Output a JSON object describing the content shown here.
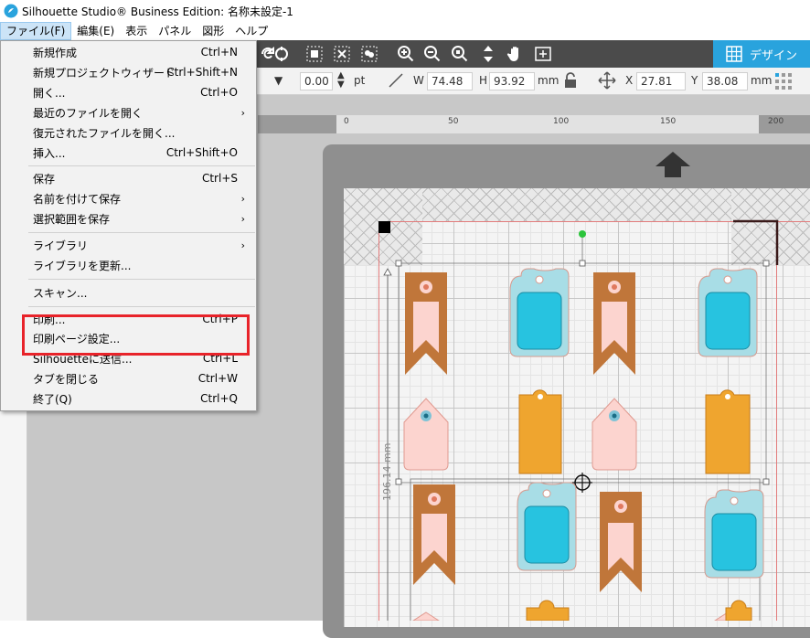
{
  "window": {
    "title": "Silhouette Studio® Business Edition: 名称未設定-1"
  },
  "menubar": {
    "items": [
      {
        "label": "ファイル(F)"
      },
      {
        "label": "編集(E)"
      },
      {
        "label": "表示"
      },
      {
        "label": "パネル"
      },
      {
        "label": "図形"
      },
      {
        "label": "ヘルプ"
      }
    ]
  },
  "file_menu": {
    "items": [
      {
        "label": "新規作成",
        "shortcut": "Ctrl+N"
      },
      {
        "label": "新規プロジェクトウィザード",
        "shortcut": "Ctrl+Shift+N"
      },
      {
        "label": "開く...",
        "shortcut": "Ctrl+O"
      },
      {
        "label": "最近のファイルを開く",
        "shortcut": "›"
      },
      {
        "label": "復元されたファイルを開く..."
      },
      {
        "label": "挿入...",
        "shortcut": "Ctrl+Shift+O"
      },
      {
        "label": "保存",
        "shortcut": "Ctrl+S"
      },
      {
        "label": "名前を付けて保存",
        "shortcut": "›"
      },
      {
        "label": "選択範囲を保存",
        "shortcut": "›"
      },
      {
        "label": "ライブラリ",
        "shortcut": "›"
      },
      {
        "label": "ライブラリを更新..."
      },
      {
        "label": "スキャン..."
      },
      {
        "label": "印刷...",
        "shortcut": "Ctrl+P"
      },
      {
        "label": "印刷ページ設定..."
      },
      {
        "label": "Silhouetteに送信...",
        "shortcut": "Ctrl+L"
      },
      {
        "label": "タブを閉じる",
        "shortcut": "Ctrl+W"
      },
      {
        "label": "終了(Q)",
        "shortcut": "Ctrl+Q"
      }
    ]
  },
  "design_tab": {
    "label": "デザイン"
  },
  "toolbar2": {
    "line_width": "0.00",
    "line_unit": "pt",
    "w_label": "W",
    "w_value": "74.48",
    "h_label": "H",
    "h_value": "93.92",
    "size_unit": "mm",
    "x_label": "X",
    "x_value": "27.81",
    "y_label": "Y",
    "y_value": "38.08",
    "pos_unit": "mm"
  },
  "ruler": {
    "ticks": [
      "0",
      "50",
      "100",
      "150",
      "200"
    ]
  },
  "canvas": {
    "dimension_label": "196.14 mm"
  },
  "colors": {
    "toolbar_dark": "#4b4b4b",
    "accent_blue": "#29a3dd",
    "highlight_red": "#e8232a",
    "tag_brown": "#c0763a",
    "tag_pink": "#fcd4cf",
    "tag_blue": "#27c3e0",
    "tag_lightblue": "#a8dde6",
    "tag_orange": "#efa52f"
  }
}
